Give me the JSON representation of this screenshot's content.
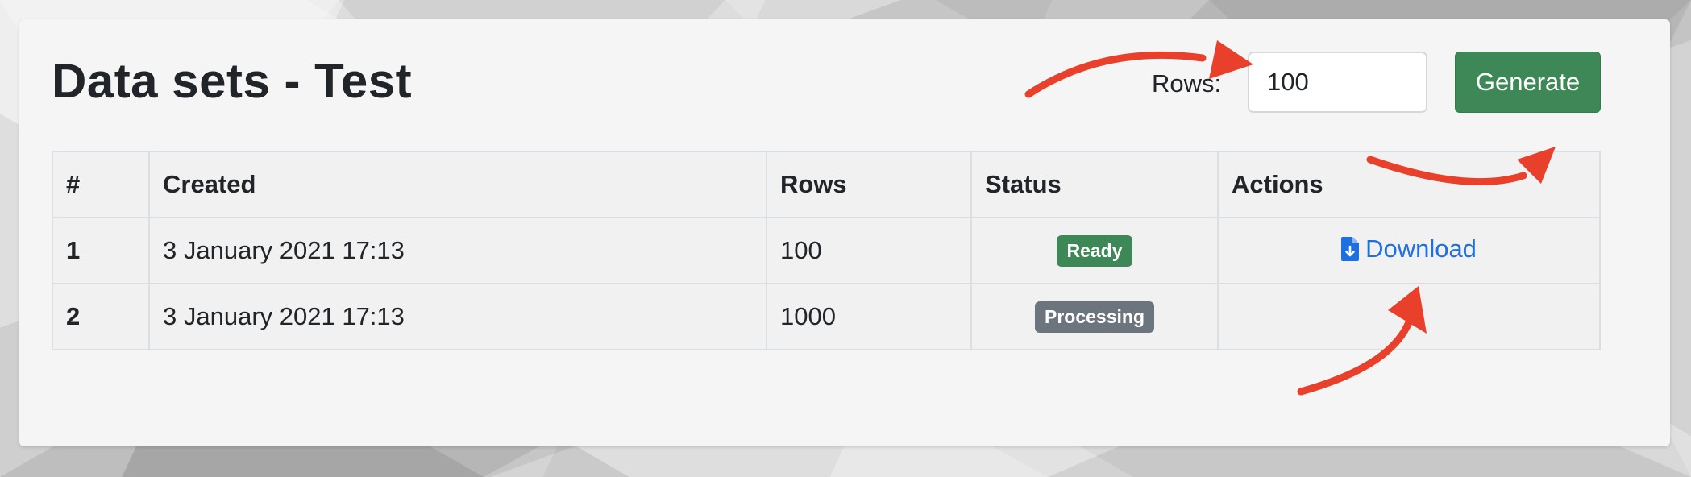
{
  "page": {
    "title": "Data sets - Test"
  },
  "form": {
    "rows_label": "Rows:",
    "rows_value": "100",
    "generate_label": "Generate"
  },
  "table": {
    "headers": [
      "#",
      "Created",
      "Rows",
      "Status",
      "Actions"
    ],
    "rows": [
      {
        "num": "1",
        "created": "3 January 2021 17:13",
        "rows": "100",
        "status": "Ready",
        "status_color": "#3e8756",
        "action": "Download"
      },
      {
        "num": "2",
        "created": "3 January 2021 17:13",
        "rows": "1000",
        "status": "Processing",
        "status_color": "#6c757d",
        "action": ""
      }
    ]
  },
  "icons": {
    "download": "file-download-icon"
  },
  "colors": {
    "accent_green": "#3e8756",
    "link_blue": "#1e6fe0",
    "annotation_red": "#e8402a"
  }
}
